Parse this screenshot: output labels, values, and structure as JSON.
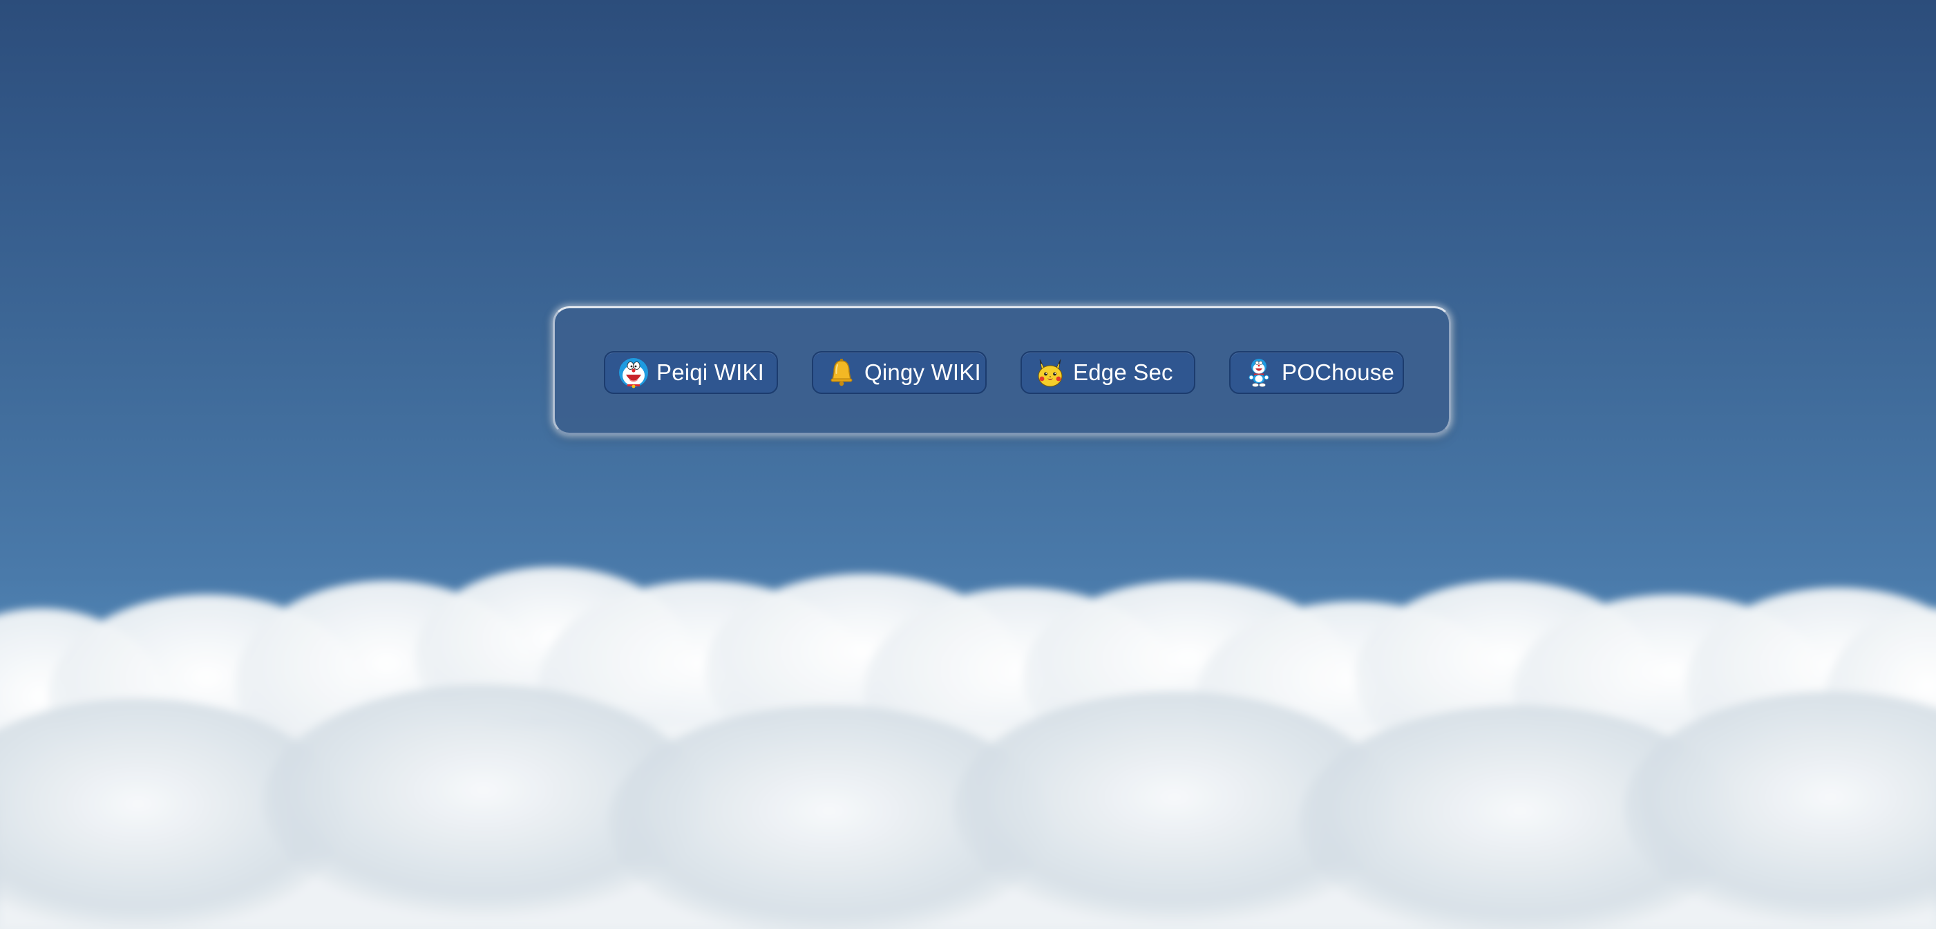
{
  "links": [
    {
      "label": "Peiqi WIKI",
      "icon": "doraemon-face-icon"
    },
    {
      "label": "Qingy WIKI",
      "icon": "bell-icon"
    },
    {
      "label": "Edge Sec",
      "icon": "pikachu-icon"
    },
    {
      "label": "POChouse",
      "icon": "doraemon-figure-icon"
    }
  ],
  "colors": {
    "sky_top": "#2c4d7b",
    "sky_bottom": "#5389b8",
    "panel": "#3c608e",
    "button": "#2f5690",
    "button_border": "#1c3c6e",
    "text": "#ffffff"
  }
}
